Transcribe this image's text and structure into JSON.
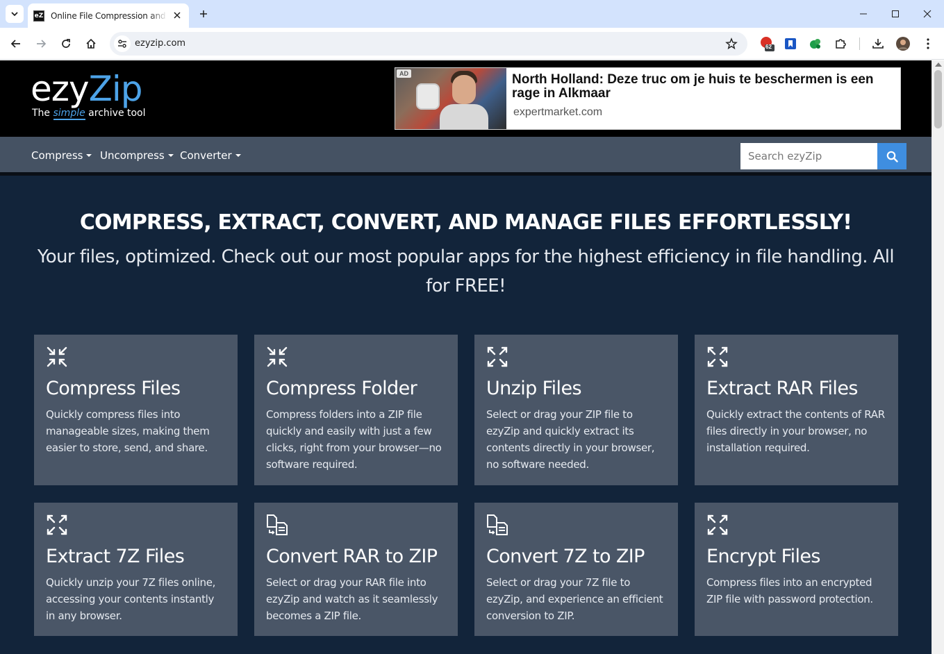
{
  "browser": {
    "tab_title": "Online File Compression and Conversion",
    "favicon_text": "eZ",
    "url": "ezyzip.com",
    "extension_badge": "62"
  },
  "site": {
    "logo": {
      "part1": "ezy",
      "part2": "Zip",
      "tagline_prefix": "The ",
      "tagline_emphasis": "simple",
      "tagline_suffix": " archive tool"
    },
    "ad": {
      "badge": "AD",
      "title": "North Holland: Deze truc om je huis te beschermen is een rage in Alkmaar",
      "domain": "expertmarket.com"
    },
    "nav": {
      "items": [
        {
          "label": "Compress"
        },
        {
          "label": "Uncompress"
        },
        {
          "label": "Converter"
        }
      ],
      "search_placeholder": "Search ezyZip"
    },
    "hero": {
      "title": "COMPRESS, EXTRACT, CONVERT, AND MANAGE FILES EFFORTLESSLY!",
      "subtitle": "Your files, optimized. Check out our most popular apps for the highest efficiency in file handling. All for FREE!"
    },
    "cards": [
      {
        "icon": "compress-icon",
        "title": "Compress Files",
        "desc": "Quickly compress files into manageable sizes, making them easier to store, send, and share."
      },
      {
        "icon": "compress-icon",
        "title": "Compress Folder",
        "desc": "Compress folders into a ZIP file quickly and easily with just a few clicks, right from your browser—no software required."
      },
      {
        "icon": "expand-icon",
        "title": "Unzip Files",
        "desc": "Select or drag your ZIP file to ezyZip and quickly extract its contents directly in your browser, no software needed."
      },
      {
        "icon": "expand-icon",
        "title": "Extract RAR Files",
        "desc": "Quickly extract the contents of RAR files directly in your browser, no installation required."
      },
      {
        "icon": "expand-icon",
        "title": "Extract 7Z Files",
        "desc": "Quickly unzip your 7Z files online, accessing your contents instantly in any browser."
      },
      {
        "icon": "convert-file-icon",
        "title": "Convert RAR to ZIP",
        "desc": "Select or drag your RAR file into ezyZip and watch as it seamlessly becomes a ZIP file."
      },
      {
        "icon": "convert-file-icon",
        "title": "Convert 7Z to ZIP",
        "desc": "Select or drag your 7Z file to ezyZip, and experience an efficient conversion to ZIP."
      },
      {
        "icon": "expand-icon",
        "title": "Encrypt Files",
        "desc": "Compress files into an encrypted ZIP file with password protection."
      }
    ]
  },
  "colors": {
    "page_bg": "#12243a",
    "card_bg": "#4a5667",
    "navbar_bg": "#455263",
    "accent": "#3f8ee0"
  }
}
